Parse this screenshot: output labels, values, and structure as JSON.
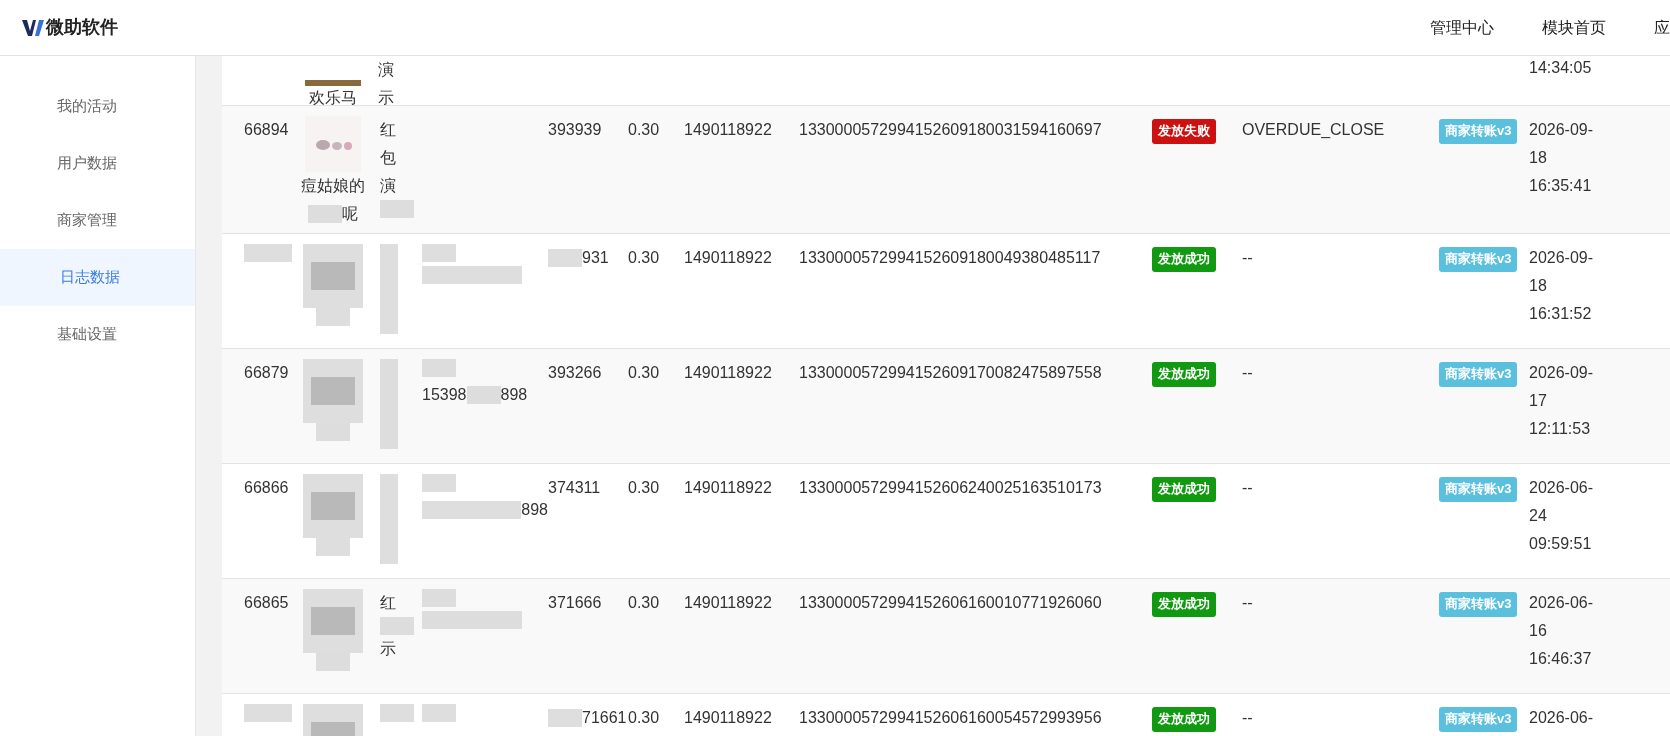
{
  "header": {
    "brand": "微助软件",
    "nav": [
      "管理中心",
      "模块首页",
      "应"
    ]
  },
  "sidebar": {
    "items": [
      {
        "label": "我的活动",
        "selected": false
      },
      {
        "label": "用户数据",
        "selected": false
      },
      {
        "label": "商家管理",
        "selected": false
      },
      {
        "label": "日志数据",
        "selected": true
      },
      {
        "label": "基础设置",
        "selected": false
      }
    ]
  },
  "top_row": {
    "avatar_caption": "欢乐马",
    "name": "演示",
    "time": "14:34:05"
  },
  "rows": [
    {
      "id": [
        {
          "text": "66894"
        }
      ],
      "avatar": {
        "kind": "photo"
      },
      "caption": [
        [
          {
            "text": "痘姑娘的"
          }
        ],
        [
          {
            "kind": "blur"
          },
          {
            "text": "呢"
          }
        ]
      ],
      "name": [
        {
          "text": "红包演"
        },
        {
          "kind": "blur"
        }
      ],
      "contact": [],
      "number": [
        {
          "text": "393939"
        }
      ],
      "amount": "0.30",
      "openid": "1490118922",
      "order_no": "1330000572994152609180031594160697",
      "status": {
        "label": "发放失败",
        "kind": "failed"
      },
      "reason": "OVERDUE_CLOSE",
      "channel": "商家转账v3",
      "time": "2026-09-18 16:35:41"
    },
    {
      "id": [
        {
          "kind": "blur_wide"
        }
      ],
      "avatar": {
        "kind": "blur"
      },
      "caption": [
        [
          {
            "kind": "blur"
          }
        ]
      ],
      "name": [
        {
          "kind": "blur_tall"
        }
      ],
      "contact": [
        [
          {
            "kind": "blur"
          }
        ],
        [
          {
            "kind": "blur_wide"
          }
        ]
      ],
      "number": [
        {
          "kind": "blur"
        },
        {
          "text": "931"
        }
      ],
      "amount": "0.30",
      "openid": "1490118922",
      "order_no": "1330000572994152609180049380485117",
      "status": {
        "label": "发放成功",
        "kind": "success"
      },
      "reason": "--",
      "channel": "商家转账v3",
      "time": "2026-09-18 16:31:52"
    },
    {
      "id": [
        {
          "text": "66879"
        }
      ],
      "avatar": {
        "kind": "blur"
      },
      "caption": [
        [
          {
            "kind": "blur"
          }
        ]
      ],
      "name": [
        {
          "kind": "blur_tall"
        }
      ],
      "contact": [
        [
          {
            "kind": "blur"
          }
        ],
        [
          {
            "text": "15398"
          },
          {
            "kind": "blur"
          },
          {
            "text": "898"
          }
        ]
      ],
      "number": [
        {
          "text": "393266"
        }
      ],
      "amount": "0.30",
      "openid": "1490118922",
      "order_no": "1330000572994152609170082475897558",
      "status": {
        "label": "发放成功",
        "kind": "success"
      },
      "reason": "--",
      "channel": "商家转账v3",
      "time": "2026-09-17 12:11:53"
    },
    {
      "id": [
        {
          "text": "66866"
        }
      ],
      "avatar": {
        "kind": "blur"
      },
      "caption": [
        [
          {
            "kind": "blur"
          }
        ]
      ],
      "name": [
        {
          "kind": "blur_tall"
        }
      ],
      "contact": [
        [
          {
            "kind": "blur"
          }
        ],
        [
          {
            "kind": "blur_wide"
          },
          {
            "text": "898"
          }
        ]
      ],
      "number": [
        {
          "text": "374311"
        }
      ],
      "amount": "0.30",
      "openid": "1490118922",
      "order_no": "1330000572994152606240025163510173",
      "status": {
        "label": "发放成功",
        "kind": "success"
      },
      "reason": "--",
      "channel": "商家转账v3",
      "time": "2026-06-24 09:59:51"
    },
    {
      "id": [
        {
          "text": "66865"
        }
      ],
      "avatar": {
        "kind": "blur"
      },
      "caption": [
        [
          {
            "kind": "blur"
          }
        ]
      ],
      "name": [
        {
          "text": "红"
        },
        {
          "kind": "blur"
        },
        {
          "text": "示"
        }
      ],
      "contact": [
        [
          {
            "kind": "blur"
          }
        ],
        [
          {
            "kind": "blur_wide"
          }
        ]
      ],
      "number": [
        {
          "text": "371666"
        }
      ],
      "amount": "0.30",
      "openid": "1490118922",
      "order_no": "1330000572994152606160010771926060",
      "status": {
        "label": "发放成功",
        "kind": "success"
      },
      "reason": "--",
      "channel": "商家转账v3",
      "time": "2026-06-16 16:46:37"
    },
    {
      "id": [
        {
          "kind": "blur_wide"
        }
      ],
      "avatar": {
        "kind": "blur"
      },
      "caption": [],
      "name": [
        {
          "kind": "blur"
        }
      ],
      "contact": [
        [
          {
            "kind": "blur"
          }
        ]
      ],
      "number": [
        {
          "kind": "blur"
        },
        {
          "text": "71661"
        }
      ],
      "amount": "0.30",
      "openid": "1490118922",
      "order_no": "1330000572994152606160054572993956",
      "status": {
        "label": "发放成功",
        "kind": "success"
      },
      "reason": "--",
      "channel": "商家转账v3",
      "time": "2026-06-"
    }
  ]
}
